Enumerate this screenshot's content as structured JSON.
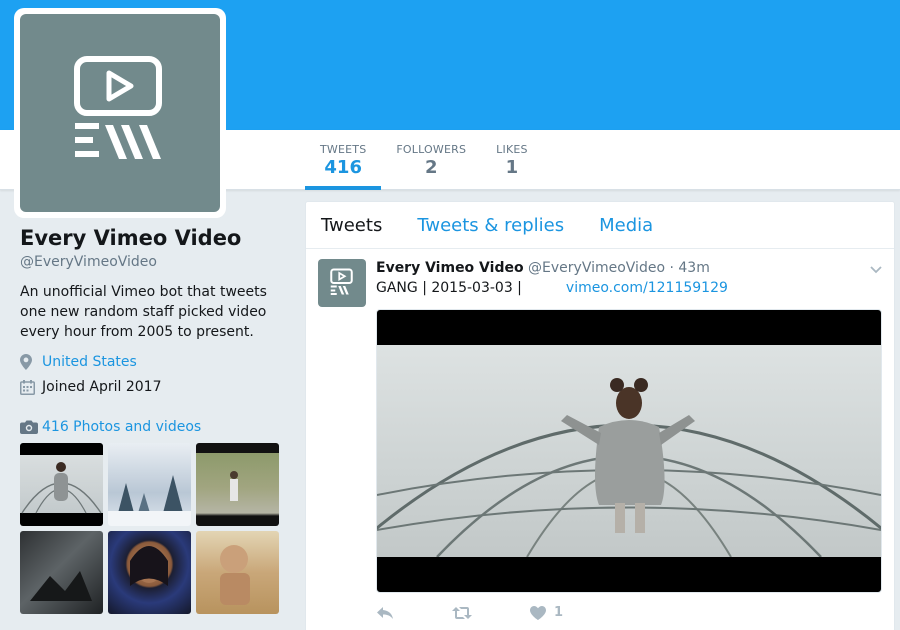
{
  "profile": {
    "name": "Every Vimeo Video",
    "handle": "@EveryVimeoVideo",
    "bio": "An unofficial Vimeo bot that tweets one new random staff picked video every hour from 2005 to present.",
    "location": "United States",
    "joined": "Joined April 2017",
    "photos_link": "416 Photos and videos"
  },
  "stats": [
    {
      "label": "TWEETS",
      "value": "416"
    },
    {
      "label": "FOLLOWERS",
      "value": "2"
    },
    {
      "label": "LIKES",
      "value": "1"
    }
  ],
  "tabs": [
    "Tweets",
    "Tweets & replies",
    "Media"
  ],
  "tweet": {
    "name": "Every Vimeo Video",
    "handle": "@EveryVimeoVideo",
    "time": "· 43m",
    "text": "GANG | 2015-03-03 |",
    "link": "vimeo.com/121159129",
    "like_count": "1"
  },
  "colors": {
    "banner": "#1da1f2",
    "accent": "#1b95e0",
    "avatar_bg": "#728a8c"
  },
  "icons": [
    "vimeo-logo-icon",
    "location-pin-icon",
    "calendar-icon",
    "camera-icon",
    "chevron-down-icon",
    "reply-icon",
    "retweet-icon",
    "heart-icon"
  ]
}
